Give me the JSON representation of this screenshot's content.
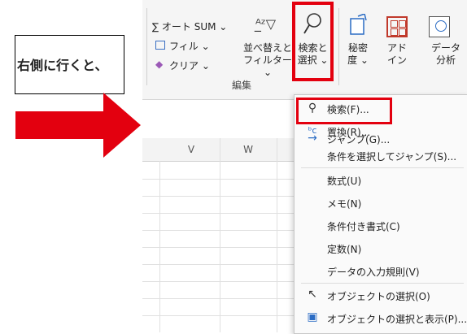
{
  "ribbon": {
    "autosum": "∑ オート SUM ⌄",
    "fill": "フィル ⌄",
    "clear": "クリア ⌄",
    "sort_filter_line1": "並べ替えと",
    "sort_filter_line2": "フィルター ⌄",
    "find_select_line1": "検索と",
    "find_select_line2": "選択 ⌄",
    "sensitivity_line1": "秘密",
    "sensitivity_line2": "度 ⌄",
    "addins_line1": "アド",
    "addins_line2": "イン",
    "analyze_line1": "データ",
    "analyze_line2": "分析",
    "group_label": "編集"
  },
  "callout": {
    "text": "右側に行くと、"
  },
  "grid": {
    "columns": [
      "V",
      "W"
    ]
  },
  "menu": {
    "items": [
      "検索(F)...",
      "置換(R)...",
      "ジャンプ(G)...",
      "条件を選択してジャンプ(S)...",
      "数式(U)",
      "メモ(N)",
      "条件付き書式(C)",
      "定数(N)",
      "データの入力規則(V)",
      "オブジェクトの選択(O)",
      "オブジェクトの選択と表示(P)..."
    ]
  },
  "colors": {
    "highlight": "#e3000f",
    "ribbon_bg": "#f5f5f5",
    "accent_blue": "#2b6cc4"
  }
}
